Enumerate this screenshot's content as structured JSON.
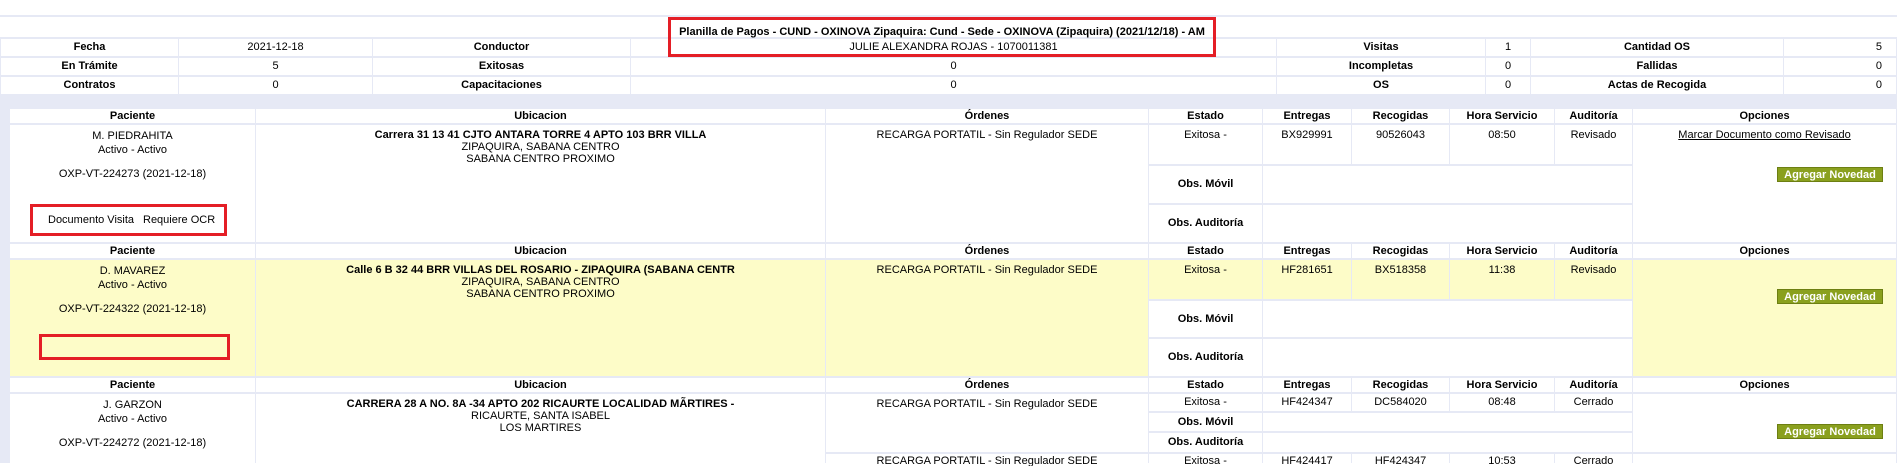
{
  "header": {
    "title_line1": "Planilla de Pagos - CUND - OXINOVA Zipaquira: Cund - Sede - OXINOVA (Zipaquira) (2021/12/18) - AM",
    "conductor_value": "JULIE ALEXANDRA ROJAS - 1070011381"
  },
  "summary": {
    "fecha_label": "Fecha",
    "fecha_value": "2021-12-18",
    "conductor_label": "Conductor",
    "visitas_label": "Visitas",
    "visitas_value": "1",
    "cantidad_os_label": "Cantidad OS",
    "cantidad_os_value": "5",
    "en_tramite_label": "En Trámite",
    "en_tramite_value": "5",
    "exitosas_label": "Exitosas",
    "exitosas_value": "0",
    "incompletas_label": "Incompletas",
    "incompletas_value": "0",
    "fallidas_label": "Fallidas",
    "fallidas_value": "0",
    "contratos_label": "Contratos",
    "contratos_value": "0",
    "capacitaciones_label": "Capacitaciones",
    "capacitaciones_value": "0",
    "os_label": "OS",
    "os_value": "0",
    "actas_label": "Actas de Recogida",
    "actas_value": "0"
  },
  "columns": {
    "paciente": "Paciente",
    "ubicacion": "Ubicacion",
    "ordenes": "Órdenes",
    "estado": "Estado",
    "entregas": "Entregas",
    "recogidas": "Recogidas",
    "hora": "Hora Servicio",
    "auditoria": "Auditoría",
    "opciones": "Opciones"
  },
  "labels": {
    "obs_movil": "Obs. Móvil",
    "obs_auditoria": "Obs. Auditoría",
    "agregar_novedad": "Agregar Novedad",
    "marcar_revisado": "Marcar Documento como Revisado",
    "documento_visita": "Documento Visita",
    "requiere_ocr": "Requiere OCR"
  },
  "rows": [
    {
      "paciente": "M. PIEDRAHITA",
      "estado_paciente": "Activo - Activo",
      "os": "OXP-VT-224273 (2021-12-18)",
      "ubicacion_1": "Carrera 31 13 41 CJTO ANTARA TORRE 4 APTO 103 BRR VILLA",
      "ubicacion_2": "ZIPAQUIRA, SABANA CENTRO",
      "ubicacion_3": "SABANA CENTRO PROXIMO",
      "orden": "RECARGA PORTATIL - Sin Regulador SEDE",
      "estado": "Exitosa -",
      "entregas": "BX929991",
      "recogidas": "90526043",
      "hora": "08:50",
      "auditoria": "Revisado"
    },
    {
      "paciente": "D. MAVAREZ",
      "estado_paciente": "Activo - Activo",
      "os": "OXP-VT-224322 (2021-12-18)",
      "ubicacion_1": "Calle 6 B 32 44 BRR VILLAS DEL ROSARIO - ZIPAQUIRA (SABANA CENTR",
      "ubicacion_2": "ZIPAQUIRA, SABANA CENTRO",
      "ubicacion_3": "SABANA CENTRO PROXIMO",
      "orden": "RECARGA PORTATIL - Sin Regulador SEDE",
      "estado": "Exitosa -",
      "entregas": "HF281651",
      "recogidas": "BX518358",
      "hora": "11:38",
      "auditoria": "Revisado"
    },
    {
      "paciente": "J. GARZON",
      "estado_paciente": "Activo - Activo",
      "os": "OXP-VT-224272 (2021-12-18)",
      "ubicacion_1": "CARRERA 28 A NO. 8A -34 APTO 202 RICAURTE LOCALIDAD MÃRTIRES -",
      "ubicacion_2": "RICAURTE, SANTA ISABEL",
      "ubicacion_3": "LOS MARTIRES",
      "orden": "RECARGA PORTATIL - Sin Regulador SEDE",
      "estado": "Exitosa -",
      "entregas": "HF424347",
      "recogidas": "DC584020",
      "hora": "08:48",
      "auditoria": "Cerrado",
      "orden_b": "RECARGA PORTATIL - Sin Regulador SEDE",
      "estado_b": "Exitosa -",
      "entregas_b": "HF424417",
      "recogidas_b": "HF424347",
      "hora_b": "10:53",
      "auditoria_b": "Cerrado"
    }
  ]
}
